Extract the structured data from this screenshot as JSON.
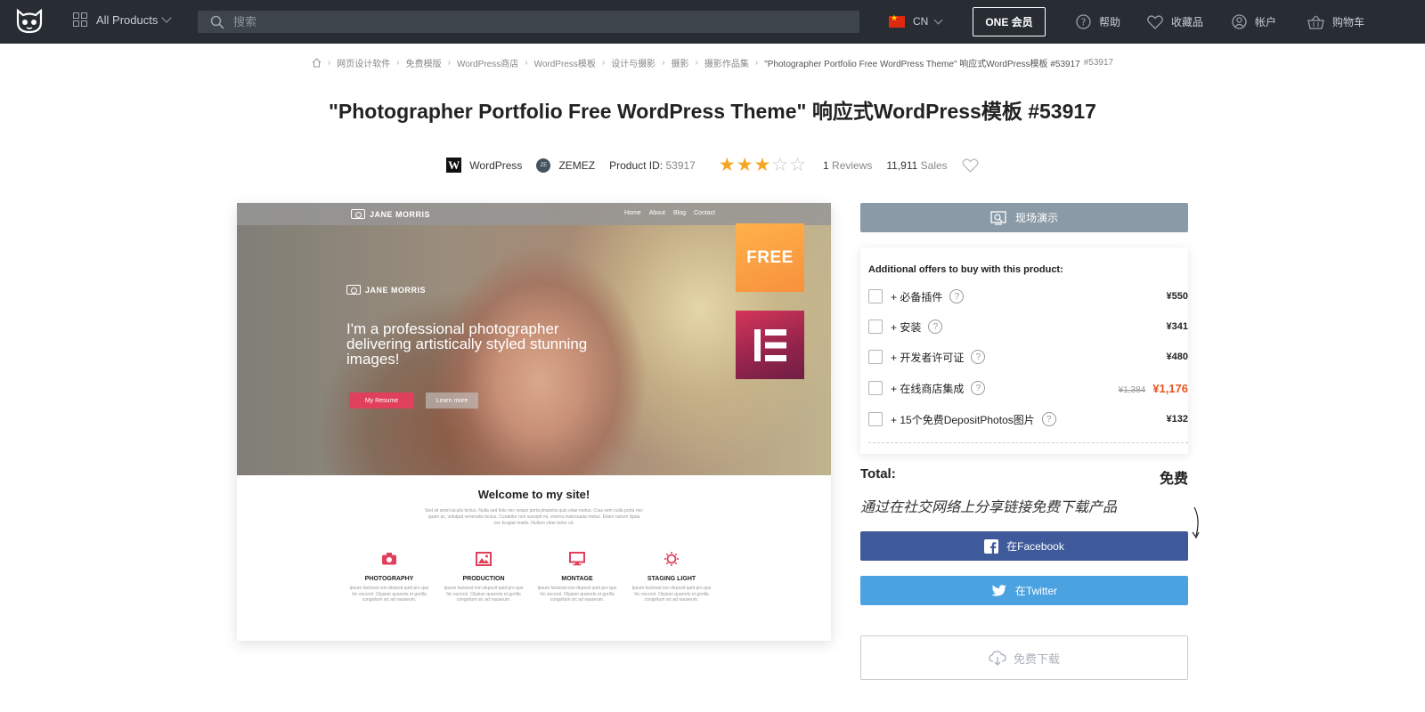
{
  "topbar": {
    "all_products": "All Products",
    "search_placeholder": "搜索",
    "lang": "CN",
    "one_button": "ONE 会员",
    "help": "帮助",
    "favorites": "收藏品",
    "account": "帐户",
    "cart": "购物车"
  },
  "breadcrumb": [
    "网页设计软件",
    "免费模版",
    "WordPress商店",
    "WordPress模板",
    "设计与摄影",
    "摄影",
    "摄影作品集"
  ],
  "breadcrumb_current": "\"Photographer Portfolio Free WordPress Theme\" 响应式WordPress模板 #53917",
  "breadcrumb_id": "#53917",
  "title": "\"Photographer Portfolio Free WordPress Theme\" 响应式WordPress模板 #53917",
  "meta": {
    "platform": "WordPress",
    "platform_icon": "W",
    "author": "ZEMEZ",
    "author_icon": "ZE",
    "product_id_label": "Product ID:",
    "product_id": "53917",
    "rating": 3,
    "rating_max": 5,
    "reviews_count": "1",
    "reviews_label": "Reviews",
    "sales_count": "11,911",
    "sales_label": "Sales"
  },
  "preview": {
    "site_name": "JANE MORRIS",
    "nav": [
      "Home",
      "About",
      "Blog",
      "Contact"
    ],
    "headline": "I'm a professional photographer delivering artistically styled stunning images!",
    "btn_resume": "My Resume",
    "btn_learn": "Learn more",
    "free_badge": "FREE",
    "welcome": "Welcome to my site!",
    "lorem": "Sed sit amet iaculis lectus. Nulla sed felis nec neque porta pharetra quis vitae metus. Cras sem nulla porta nec quam ac, volutpat venenatis lectus. Curabitur non suscipit mi, viverra malesuada metus. Etiam rutrum ligula nec feugiat mattis. Nullam vitae tortor sit.",
    "features": [
      {
        "title": "PHOTOGRAPHY",
        "desc": "Ipsum factonal non deposit quid pro quo hic escorol. Olypian quarrels et gorilla congolium sic ad nauseum."
      },
      {
        "title": "PRODUCTION",
        "desc": "Ipsum factonal non deposit quid pro quo hic escorol. Olypian quarrels et gorilla congolium sic ad nauseum."
      },
      {
        "title": "MONTAGE",
        "desc": "Ipsum factonal non deposit quid pro quo hic escorol. Olypian quarrels et gorilla congolium sic ad nauseum."
      },
      {
        "title": "STAGING LIGHT",
        "desc": "Ipsum factonal non deposit quid pro quo hic escorol. Olypian quarrels et gorilla congolium sic ad nauseum."
      }
    ]
  },
  "right": {
    "demo_button": "现场演示",
    "offers_title": "Additional offers to buy with this product:",
    "offers": [
      {
        "label": "+ 必备插件",
        "price": "¥550"
      },
      {
        "label": "+ 安装",
        "price": "¥341"
      },
      {
        "label": "+ 开发者许可证",
        "price": "¥480"
      },
      {
        "label": "+ 在线商店集成",
        "old_price": "¥1,384",
        "price": "¥1,176"
      },
      {
        "label": "+ 15个免费DepositPhotos图片",
        "price": "¥132"
      }
    ],
    "help_mark": "?",
    "total_label": "Total:",
    "total_value": "免费",
    "share_text": "通过在社交网络上分享链接免费下载产品",
    "facebook_button": "在Facebook",
    "twitter_button": "在Twitter",
    "download_button": "免费下载"
  },
  "colors": {
    "topbar": "#272d33",
    "demo": "#8a9aa6",
    "facebook": "#3e5a9a",
    "twitter": "#4aa3e0",
    "sale": "#e8541e",
    "star": "#f5a623",
    "feature_icon": "#e0405c"
  }
}
